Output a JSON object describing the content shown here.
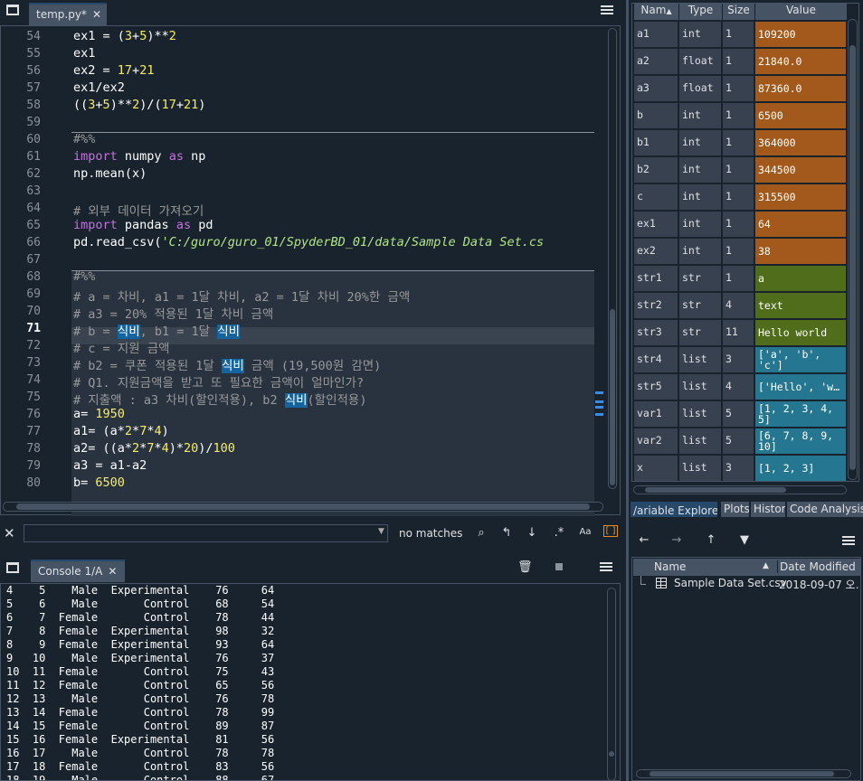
{
  "editor": {
    "tab_label": "temp.py*",
    "lines": [
      {
        "n": "54",
        "html": "ex1 = (<span class='num'>3</span>+<span class='num'>5</span>)**<span class='num'>2</span>"
      },
      {
        "n": "55",
        "html": "ex1"
      },
      {
        "n": "56",
        "html": "ex2 = <span class='num'>17</span>+<span class='num'>21</span>"
      },
      {
        "n": "57",
        "html": "ex1/ex2"
      },
      {
        "n": "58",
        "html": "((<span class='num'>3</span>+<span class='num'>5</span>)**<span class='num'>2</span>)/(<span class='num'>17</span>+<span class='num'>21</span>)"
      },
      {
        "n": "59",
        "html": ""
      },
      {
        "n": "60",
        "html": "<span class='cm'>#%%</span>"
      },
      {
        "n": "61",
        "html": "<span class='kw'>import</span> numpy <span class='kw'>as</span> np"
      },
      {
        "n": "62",
        "html": "np.mean(x)"
      },
      {
        "n": "63",
        "html": ""
      },
      {
        "n": "64",
        "html": "<span class='cm'># 외부 데이터 가져오기</span>"
      },
      {
        "n": "65",
        "html": "<span class='kw'>import</span> pandas <span class='kw'>as</span> pd"
      },
      {
        "n": "66",
        "html": "pd.read_csv(<span class='str'>'C:/guro/guro_01/SpyderBD_01/data/Sample Data Set.cs</span>"
      },
      {
        "n": "67",
        "html": ""
      },
      {
        "n": "68",
        "html": "<span class='cm'>#%%</span>"
      },
      {
        "n": "69",
        "html": "<span class='cm'># a = 차비, a1 = 1달 차비, a2 = 1달 차비 20%한 금액</span>"
      },
      {
        "n": "70",
        "html": "<span class='cm'># a3 = 20% 적용된 1달 차비 금액</span>"
      },
      {
        "n": "71",
        "html": "<span class='cm'># b = <span class='hl'>식비</span>, b1 = 1달 <span class='hl'>식비</span></span>"
      },
      {
        "n": "72",
        "html": "<span class='cm'># c = 지원 금액</span>"
      },
      {
        "n": "73",
        "html": "<span class='cm'># b2 = 쿠폰 적용된 1달 <span class='hl'>식비</span> 금액 (19,500원 감면)</span>"
      },
      {
        "n": "74",
        "html": "<span class='cm'># Q1. 지원금액을 받고 또 필요한 금액이 얼마인가?</span>"
      },
      {
        "n": "75",
        "html": "<span class='cm'># 지출액 : a3 차비(할인적용), b2 <span class='hl'>식비</span>(할인적용)</span>"
      },
      {
        "n": "76",
        "html": "a= <span class='num'>1950</span>"
      },
      {
        "n": "77",
        "html": "a1= (a*<span class='num'>2</span>*<span class='num'>7</span>*<span class='num'>4</span>)"
      },
      {
        "n": "78",
        "html": "a2= ((a*<span class='num'>2</span>*<span class='num'>7</span>*<span class='num'>4</span>)*<span class='num'>20</span>)/<span class='num'>100</span>"
      },
      {
        "n": "79",
        "html": "a3 = a1-a2"
      },
      {
        "n": "80",
        "html": "b= <span class='num'>6500</span>"
      }
    ],
    "current_line": "71"
  },
  "variable_explorer": {
    "headers": {
      "name": "Nam",
      "type": "Type",
      "size": "Size",
      "value": "Value"
    },
    "rows": [
      {
        "name": "a1",
        "type": "int",
        "size": "1",
        "value": "109200",
        "color": "#a3591b"
      },
      {
        "name": "a2",
        "type": "float",
        "size": "1",
        "value": "21840.0",
        "color": "#a3591b"
      },
      {
        "name": "a3",
        "type": "float",
        "size": "1",
        "value": "87360.0",
        "color": "#a3591b"
      },
      {
        "name": "b",
        "type": "int",
        "size": "1",
        "value": "6500",
        "color": "#a3591b"
      },
      {
        "name": "b1",
        "type": "int",
        "size": "1",
        "value": "364000",
        "color": "#a3591b"
      },
      {
        "name": "b2",
        "type": "int",
        "size": "1",
        "value": "344500",
        "color": "#a3591b"
      },
      {
        "name": "c",
        "type": "int",
        "size": "1",
        "value": "315500",
        "color": "#a3591b"
      },
      {
        "name": "ex1",
        "type": "int",
        "size": "1",
        "value": "64",
        "color": "#a3591b"
      },
      {
        "name": "ex2",
        "type": "int",
        "size": "1",
        "value": "38",
        "color": "#a3591b"
      },
      {
        "name": "str1",
        "type": "str",
        "size": "1",
        "value": "a",
        "color": "#4f6d1a"
      },
      {
        "name": "str2",
        "type": "str",
        "size": "4",
        "value": "text",
        "color": "#4f6d1a"
      },
      {
        "name": "str3",
        "type": "str",
        "size": "11",
        "value": "Hello world",
        "color": "#4f6d1a"
      },
      {
        "name": "str4",
        "type": "list",
        "size": "3",
        "value": "['a', 'b', 'c']",
        "color": "#257791"
      },
      {
        "name": "str5",
        "type": "list",
        "size": "4",
        "value": "['Hello', 'w…",
        "color": "#257791"
      },
      {
        "name": "var1",
        "type": "list",
        "size": "5",
        "value": "[1, 2, 3, 4, 5]",
        "color": "#257791"
      },
      {
        "name": "var2",
        "type": "list",
        "size": "5",
        "value": "[6, 7, 8, 9, 10]",
        "color": "#257791"
      },
      {
        "name": "x",
        "type": "list",
        "size": "3",
        "value": "[1, 2, 3]",
        "color": "#257791"
      }
    ]
  },
  "pane_tabs": [
    "/ariable Explore",
    "Plots",
    "History",
    "Code Analysis"
  ],
  "find": {
    "status": "no matches",
    "regex_label": "Aa"
  },
  "console": {
    "tab_label": "Console 1/A",
    "rows": [
      "4    5    Male  Experimental    76     64",
      "5    6    Male       Control    68     54",
      "6    7  Female       Control    78     44",
      "7    8  Female  Experimental    98     32",
      "8    9  Female  Experimental    93     64",
      "9   10    Male  Experimental    76     37",
      "10  11  Female       Control    75     43",
      "11  12  Female       Control    65     56",
      "12  13    Male       Control    76     78",
      "13  14  Female       Control    78     99",
      "14  15  Female       Control    89     87",
      "15  16  Female  Experimental    81     56",
      "16  17    Male       Control    78     78",
      "17  18  Female       Control    83     56",
      "18  19    Male       Control    88     67"
    ]
  },
  "files": {
    "col_name": "Name",
    "col_date": "Date Modified",
    "items": [
      {
        "name": "Sample Data Set.csv",
        "date": "2018-09-07 오…"
      }
    ]
  }
}
